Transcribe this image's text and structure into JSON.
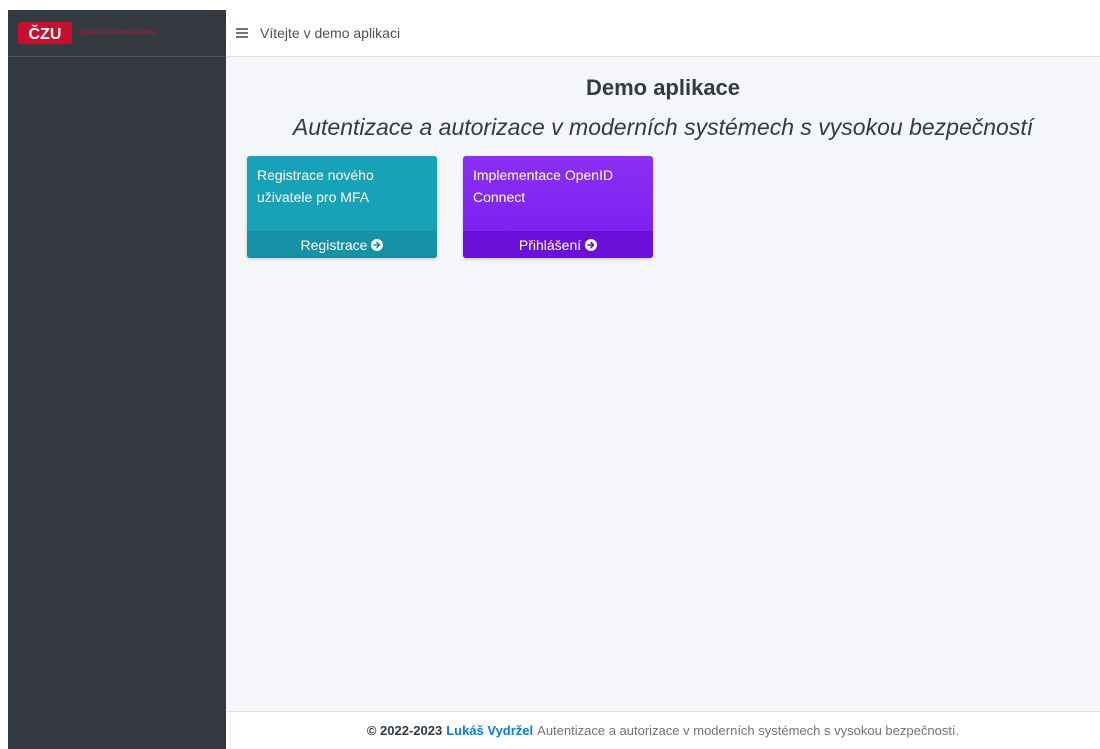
{
  "brand": {
    "logo_text": "Provozně ekonomická fakulta",
    "logo_letters": "ČZU",
    "logo_color": "#c8102e"
  },
  "header": {
    "title": "Vítejte v demo aplikaci"
  },
  "main": {
    "title": "Demo aplikace",
    "subtitle": "Autentizace a autorizace v moderních systémech s vysokou bezpečností"
  },
  "cards": [
    {
      "text": "Registrace nového uživatele pro MFA",
      "link_label": "Registrace",
      "color": "#17a2b8",
      "icon": "arrow-circle-right-icon"
    },
    {
      "text": "Implementace OpenID Connect",
      "link_label": "Přihlášení",
      "color": "#8b2ff4",
      "icon": "arrow-circle-right-icon"
    }
  ],
  "footer": {
    "years": "© 2022-2023",
    "author": "Lukáš Vydržel",
    "text": "Autentizace a autorizace v moderních systémech s vysokou bezpečností."
  },
  "colors": {
    "sidebar_bg": "#343a40",
    "content_bg": "#f4f6f9",
    "link": "#007bff"
  }
}
